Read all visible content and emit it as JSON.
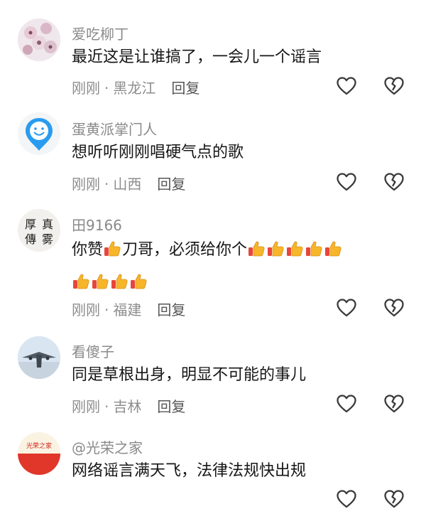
{
  "comments": [
    {
      "username": "爱吃柳丁",
      "text": "最近这是让谁搞了，一会儿一个谣言",
      "time": "刚刚",
      "location": "黑龙江",
      "reply_label": "回复",
      "avatar_icon": "flowers-avatar-icon"
    },
    {
      "username": "蛋黄派掌门人",
      "text": "想听听刚刚唱硬气点的歌",
      "time": "刚刚",
      "location": "山西",
      "reply_label": "回复",
      "avatar_icon": "smiley-avatar-icon"
    },
    {
      "username": "田9166",
      "text_before": "你赞",
      "text_middle": "刀哥，必须给你个",
      "time": "刚刚",
      "location": "福建",
      "reply_label": "回复",
      "avatar_icon": "calligraphy-avatar-icon",
      "avatar_text": [
        "厚",
        "真",
        "傳",
        "雾"
      ],
      "thumbs_after_middle": 5,
      "thumbs_second_line": 4
    },
    {
      "username": "看傻子",
      "text": "同是草根出身，明显不可能的事儿",
      "time": "刚刚",
      "location": "吉林",
      "reply_label": "回复",
      "avatar_icon": "airplane-avatar-icon"
    },
    {
      "username": "@光荣之家",
      "text": "网络谣言满天飞，法律法规快出规",
      "avatar_icon": "honor-family-avatar-icon",
      "avatar_text": "光荣之家"
    }
  ],
  "separator": "·",
  "icons": {
    "like": "heart-outline-icon",
    "dislike": "broken-heart-icon",
    "emoji": "thumbs-up-emoji-icon"
  },
  "colors": {
    "username": "#8a8a8a",
    "text": "#161616",
    "meta": "#8d8d8d",
    "icon": "#3a3a3a"
  }
}
